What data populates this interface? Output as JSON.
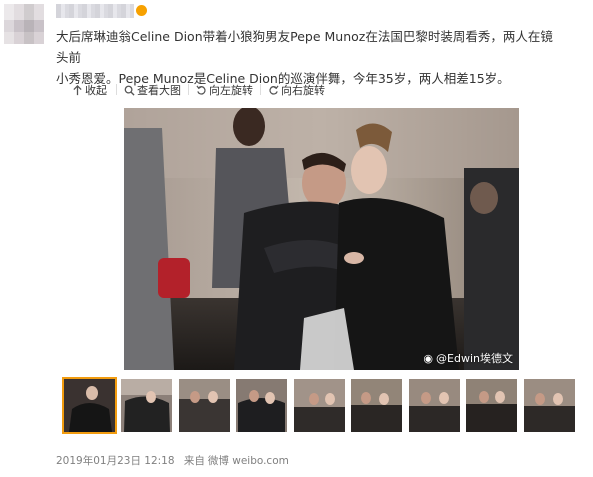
{
  "user": {
    "avatar": "blurred-user-avatar",
    "name_text": "",
    "badge_color": "#f7a100"
  },
  "post": {
    "text_line1": "大后席琳迪翁Celine Dion带着小狼狗男友Pepe Munoz在法国巴黎时装周看秀，两人在镜头前",
    "text_line2": "小秀恩爱。Pepe Munoz是Celine Dion的巡演伴舞，今年35岁，两人相差15岁。"
  },
  "actions": [
    {
      "label": "收起",
      "icon": "collapse-arrow-icon"
    },
    {
      "label": "查看大图",
      "icon": "magnify-icon"
    },
    {
      "label": "向左旋转",
      "icon": "rotate-left-icon"
    },
    {
      "label": "向右旋转",
      "icon": "rotate-right-icon"
    }
  ],
  "image": {
    "watermark": "@Edwin埃德文",
    "watermark_icon": "weibo-logo-icon"
  },
  "thumbnails_count": 9,
  "active_thumbnail": 1,
  "footer": {
    "timestamp": "2019年01月23日 12:18",
    "source_prefix": "来自",
    "source": "微博 weibo.com"
  },
  "colors": {
    "accent": "#f29c0f",
    "text": "#333333",
    "muted": "#808080"
  }
}
